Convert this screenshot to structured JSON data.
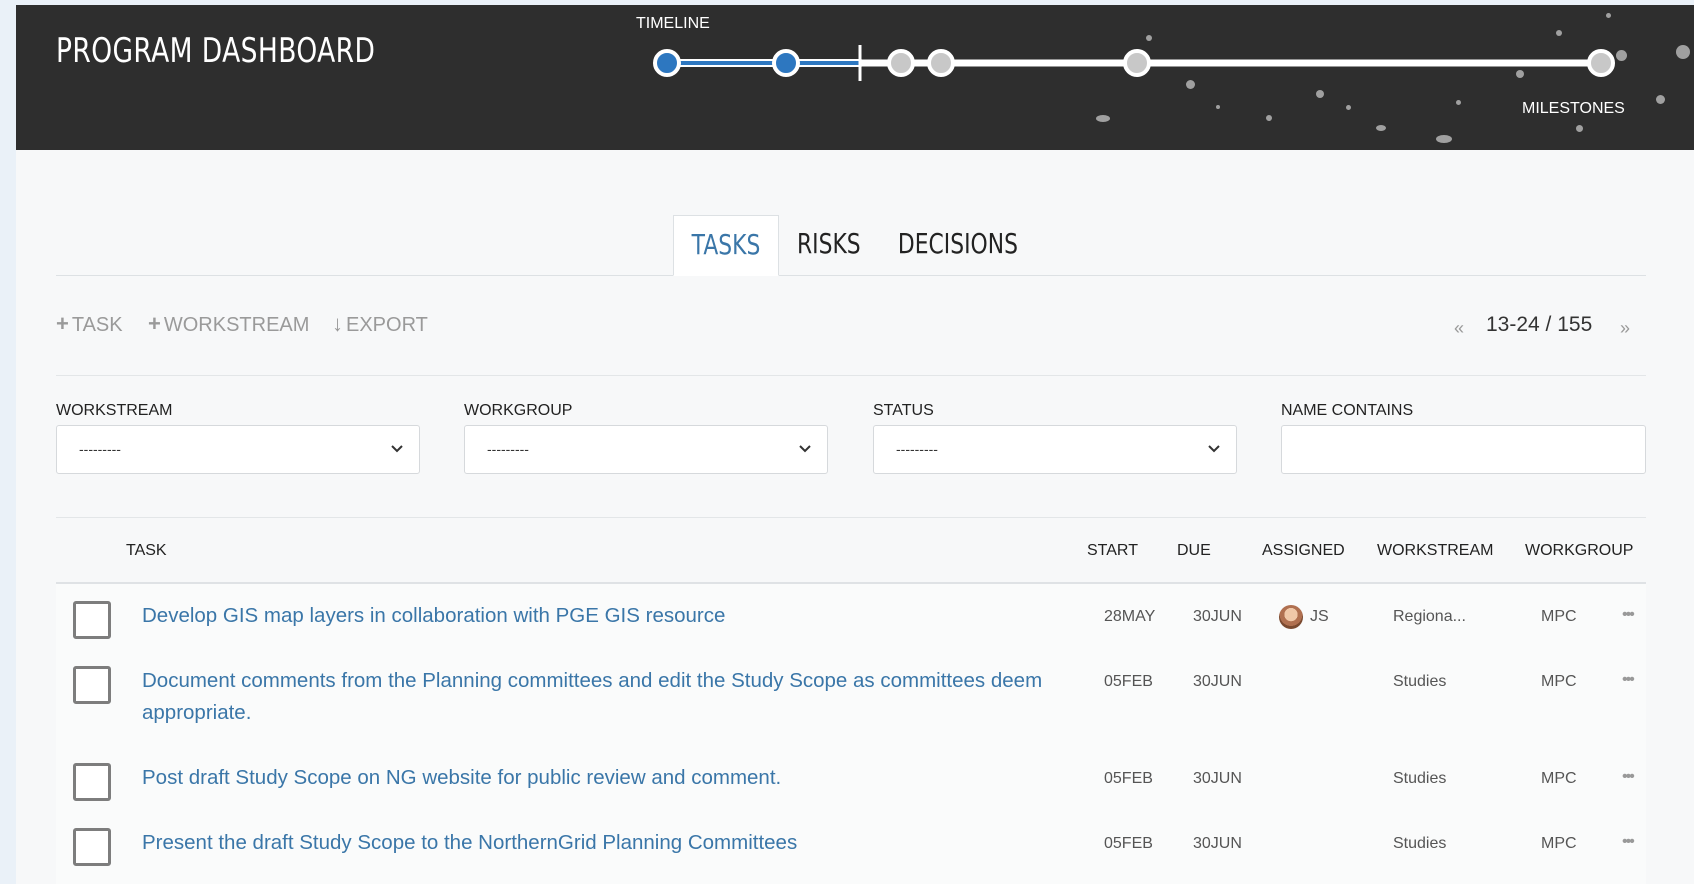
{
  "header": {
    "title": "PROGRAM DASHBOARD",
    "timeline_label": "TIMELINE",
    "milestones_label": "MILESTONES",
    "colors": {
      "background": "#2e2e2e",
      "completed": "#2d77c0",
      "pending": "#c8c8c8"
    }
  },
  "tabs": [
    {
      "label": "TASKS",
      "active": true
    },
    {
      "label": "RISKS",
      "active": false
    },
    {
      "label": "DECISIONS",
      "active": false
    }
  ],
  "toolbar": {
    "add_task_label": "TASK",
    "add_workstream_label": "WORKSTREAM",
    "export_label": "EXPORT",
    "add_icon": "plus-icon",
    "export_icon": "arrow-down-icon"
  },
  "pager": {
    "prev": "«",
    "text": "13-24 / 155",
    "next": "»"
  },
  "filters": {
    "workstream": {
      "label": "WORKSTREAM",
      "value": "---------"
    },
    "workgroup": {
      "label": "WORKGROUP",
      "value": "---------"
    },
    "status": {
      "label": "STATUS",
      "value": "---------"
    },
    "name_contains": {
      "label": "NAME CONTAINS",
      "value": "",
      "placeholder": ""
    }
  },
  "table": {
    "columns": {
      "task": "TASK",
      "start": "START",
      "due": "DUE",
      "assigned": "ASSIGNED",
      "workstream": "WORKSTREAM",
      "workgroup": "WORKGROUP"
    },
    "rows": [
      {
        "task": "Develop GIS map layers in collaboration with PGE GIS resource",
        "start": "28MAY",
        "due": "30JUN",
        "assigned": "JS",
        "has_avatar": true,
        "workstream": "Regiona...",
        "workgroup": "MPC",
        "menu": "•••"
      },
      {
        "task": "Document comments from the Planning committees and edit the Study Scope as committees deem appropriate.",
        "start": "05FEB",
        "due": "30JUN",
        "assigned": "",
        "has_avatar": false,
        "workstream": "Studies",
        "workgroup": "MPC",
        "menu": "•••"
      },
      {
        "task": "Post draft Study Scope on NG website for public review and comment.",
        "start": "05FEB",
        "due": "30JUN",
        "assigned": "",
        "has_avatar": false,
        "workstream": "Studies",
        "workgroup": "MPC",
        "menu": "•••"
      },
      {
        "task": "Present the draft Study Scope to the NorthernGrid Planning Committees",
        "start": "05FEB",
        "due": "30JUN",
        "assigned": "",
        "has_avatar": false,
        "workstream": "Studies",
        "workgroup": "MPC",
        "menu": "•••"
      }
    ]
  }
}
